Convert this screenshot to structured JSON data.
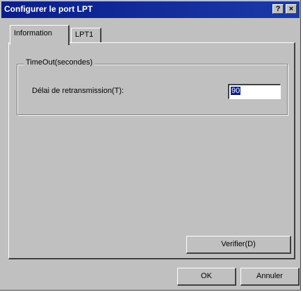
{
  "window": {
    "title": "Configurer le port LPT",
    "help_label": "?",
    "close_label": "×"
  },
  "tabs": [
    {
      "label": "Information",
      "active": true
    },
    {
      "label": "LPT1",
      "active": false
    }
  ],
  "group": {
    "legend": "TimeOut(secondes)",
    "field_label": "Délai de retransmission(T):",
    "field_value": "90"
  },
  "buttons": {
    "verify_label": "Verifier(D)",
    "ok_label": "OK",
    "cancel_label": "Annuler"
  }
}
